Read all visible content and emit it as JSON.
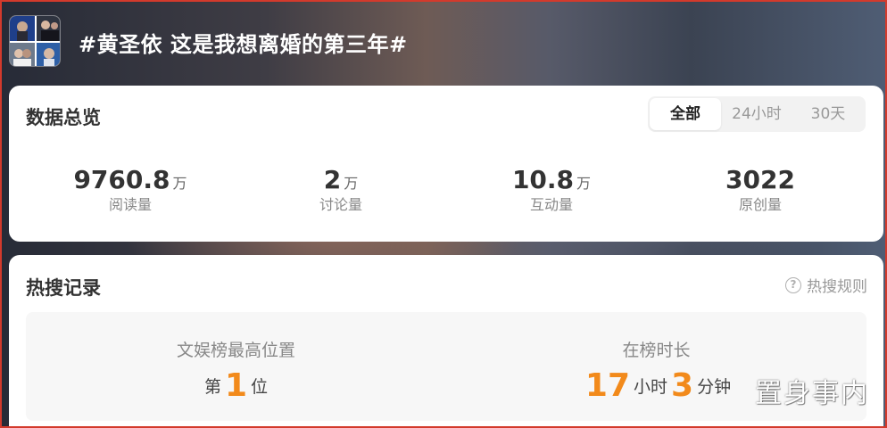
{
  "topic": {
    "title": "#黄圣依 这是我想离婚的第三年#"
  },
  "overview": {
    "title": "数据总览",
    "tabs": [
      {
        "label": "全部",
        "active": true
      },
      {
        "label": "24小时",
        "active": false
      },
      {
        "label": "30天",
        "active": false
      }
    ],
    "stats": [
      {
        "value": "9760.8",
        "unit": "万",
        "label": "阅读量"
      },
      {
        "value": "2",
        "unit": "万",
        "label": "讨论量"
      },
      {
        "value": "10.8",
        "unit": "万",
        "label": "互动量"
      },
      {
        "value": "3022",
        "unit": "",
        "label": "原创量"
      }
    ]
  },
  "hot_search": {
    "title": "热搜记录",
    "rules_label": "热搜规则",
    "rules_icon": "help-circle-icon",
    "highest": {
      "label": "文娱榜最高位置",
      "prefix": "第",
      "rank": "1",
      "suffix": "位"
    },
    "duration": {
      "label": "在榜时长",
      "hours": "17",
      "hours_unit": "小时",
      "minutes": "3",
      "minutes_unit": "分钟"
    }
  },
  "watermark": "置身事内",
  "colors": {
    "accent": "#f28a1b",
    "frame_border": "#d33a2c",
    "text_primary": "#333333",
    "text_secondary": "#888888"
  }
}
